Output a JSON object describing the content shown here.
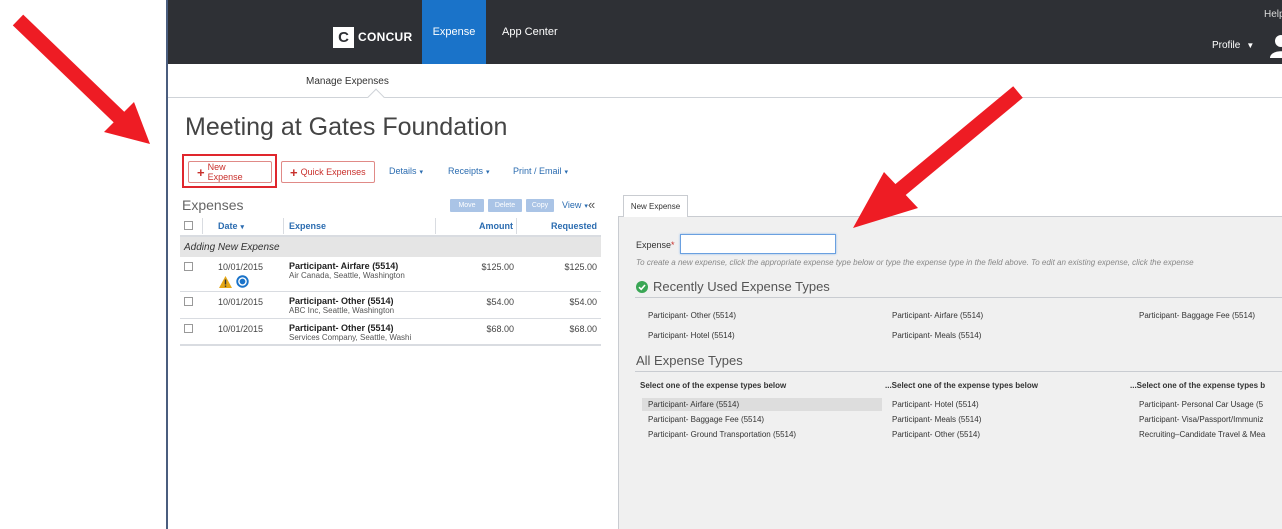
{
  "header": {
    "logo_mark": "C",
    "logo_text": "CONCUR",
    "nav": [
      "Expense",
      "App Center"
    ],
    "help": "Help",
    "profile": "Profile",
    "profile_caret": "▼"
  },
  "subnav": {
    "manage": "Manage Expenses"
  },
  "report": {
    "title": "Meeting at Gates Foundation"
  },
  "toolbar": {
    "new_expense": "New Expense",
    "quick_expenses": "Quick Expenses",
    "plus": "+",
    "details": "Details",
    "receipts": "Receipts",
    "print_email": "Print / Email",
    "caret": "▾"
  },
  "expenses_panel": {
    "heading": "Expenses",
    "buttons": [
      "Move",
      "Delete",
      "Copy"
    ],
    "view": "View",
    "collapse": "«",
    "columns": {
      "date": "Date",
      "date_sort": "▾",
      "expense": "Expense",
      "amount": "Amount",
      "requested": "Requested"
    },
    "group_label": "Adding New Expense",
    "rows": [
      {
        "date": "10/01/2015",
        "type": "Participant- Airfare (5514)",
        "vendor": "Air Canada, Seattle, Washington",
        "amount": "$125.00",
        "requested": "$125.00"
      },
      {
        "date": "10/01/2015",
        "type": "Participant- Other (5514)",
        "vendor": "ABC Inc, Seattle, Washington",
        "amount": "$54.00",
        "requested": "$54.00"
      },
      {
        "date": "10/01/2015",
        "type": "Participant- Other (5514)",
        "vendor": "Services Company, Seattle, Washi",
        "amount": "$68.00",
        "requested": "$68.00"
      }
    ]
  },
  "new_expense": {
    "tab": "New Expense",
    "field_label": "Expense",
    "required_mark": "*",
    "field_value": "",
    "hint": "To create a new expense, click the appropriate expense type below or type the expense type in the field above. To edit an existing expense, click the expense",
    "recent_title": "Recently Used Expense Types",
    "recent": [
      "Participant- Other (5514)",
      "Participant- Airfare (5514)",
      "Participant- Baggage Fee (5514)",
      "Participant- Hotel (5514)",
      "Participant- Meals (5514)"
    ],
    "all_title": "All Expense Types",
    "col_heads": [
      "Select one of the expense types below",
      "...Select one of the expense types below",
      "...Select one of the expense types b"
    ],
    "col1": [
      "Participant- Airfare (5514)",
      "Participant- Baggage Fee (5514)",
      "Participant- Ground Transportation (5514)"
    ],
    "col2": [
      "Participant- Hotel (5514)",
      "Participant- Meals (5514)",
      "Participant- Other (5514)"
    ],
    "col3": [
      "Participant- Personal Car Usage (5",
      "Participant- Visa/Passport/Immuniz",
      "Recruiting–Candidate Travel & Mea"
    ]
  },
  "colors": {
    "topbar": "#2e3035",
    "accent_blue": "#1a73c9",
    "button_red": "#c9302c",
    "arrow_red": "#ee1c24"
  }
}
